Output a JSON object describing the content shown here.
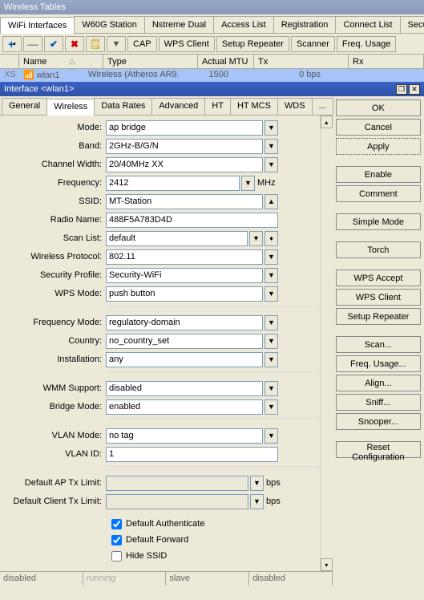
{
  "window_title": "Wireless Tables",
  "parent_tabs": [
    "WiFi Interfaces",
    "W60G Station",
    "Nstreme Dual",
    "Access List",
    "Registration",
    "Connect List",
    "Security Profi"
  ],
  "parent_active": 0,
  "toolbar_buttons": [
    "CAP",
    "WPS Client",
    "Setup Repeater",
    "Scanner",
    "Freq. Usage"
  ],
  "grid_headers": {
    "name": "Name",
    "type": "Type",
    "mtu": "Actual MTU",
    "tx": "Tx",
    "rx": "Rx"
  },
  "grid_row": {
    "flag": "XS",
    "name": "wlan1",
    "type": "Wireless (Atheros AR9...",
    "mtu": "1500",
    "tx": "0 bps",
    "rx": ""
  },
  "dialog_title": "Interface <wlan1>",
  "inner_tabs": [
    "General",
    "Wireless",
    "Data Rates",
    "Advanced",
    "HT",
    "HT MCS",
    "WDS",
    "..."
  ],
  "inner_active": 1,
  "side_buttons": [
    "OK",
    "Cancel",
    "Apply",
    "Enable",
    "Comment",
    "Simple Mode",
    "Torch",
    "WPS Accept",
    "WPS Client",
    "Setup Repeater",
    "Scan...",
    "Freq. Usage...",
    "Align...",
    "Sniff...",
    "Snooper...",
    "Reset Configuration"
  ],
  "fields": {
    "mode": {
      "label": "Mode:",
      "value": "ap bridge"
    },
    "band": {
      "label": "Band:",
      "value": "2GHz-B/G/N"
    },
    "chwidth": {
      "label": "Channel Width:",
      "value": "20/40MHz XX"
    },
    "freq": {
      "label": "Frequency:",
      "value": "2412",
      "unit": "MHz"
    },
    "ssid": {
      "label": "SSID:",
      "value": "MT-Station"
    },
    "radio": {
      "label": "Radio Name:",
      "value": "488F5A783D4D"
    },
    "scan": {
      "label": "Scan List:",
      "value": "default"
    },
    "proto": {
      "label": "Wireless Protocol:",
      "value": "802.11"
    },
    "sec": {
      "label": "Security Profile:",
      "value": "Security-WiFi"
    },
    "wps": {
      "label": "WPS Mode:",
      "value": "push button"
    },
    "fmode": {
      "label": "Frequency Mode:",
      "value": "regulatory-domain"
    },
    "country": {
      "label": "Country:",
      "value": "no_country_set"
    },
    "inst": {
      "label": "Installation:",
      "value": "any"
    },
    "wmm": {
      "label": "WMM Support:",
      "value": "disabled"
    },
    "bridge": {
      "label": "Bridge Mode:",
      "value": "enabled"
    },
    "vlanm": {
      "label": "VLAN Mode:",
      "value": "no tag"
    },
    "vlanid": {
      "label": "VLAN ID:",
      "value": "1"
    },
    "aptx": {
      "label": "Default AP Tx Limit:",
      "value": "",
      "unit": "bps"
    },
    "cltx": {
      "label": "Default Client Tx Limit:",
      "value": "",
      "unit": "bps"
    }
  },
  "checkboxes": {
    "auth": {
      "label": "Default Authenticate",
      "checked": true
    },
    "fwd": {
      "label": "Default Forward",
      "checked": true
    },
    "hide": {
      "label": "Hide SSID",
      "checked": false
    }
  },
  "status": [
    "disabled",
    "running",
    "slave",
    "disabled"
  ]
}
